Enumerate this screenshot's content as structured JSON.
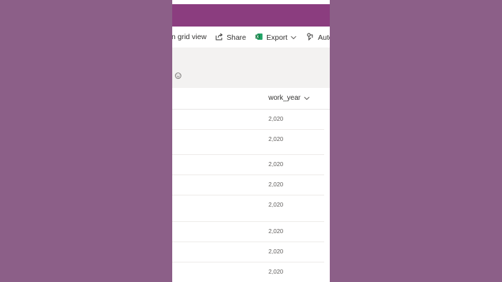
{
  "commandbar": {
    "grid_view_label": "n grid view",
    "share_label": "Share",
    "export_label": "Export",
    "automate_label": "Auto"
  },
  "table": {
    "columns": [
      "work_year"
    ],
    "rows": [
      "2,020",
      "2,020",
      "2,020",
      "2,020",
      "2,020",
      "2,020",
      "2,020",
      "2,020"
    ]
  },
  "colors": {
    "background": "#8c5f88",
    "suite_bar": "#8b3d7f",
    "excel_green": "#107c41"
  }
}
